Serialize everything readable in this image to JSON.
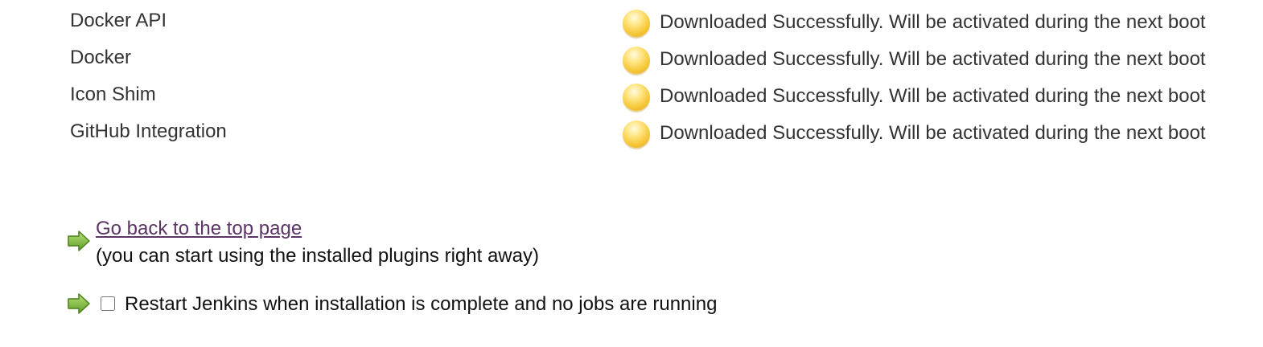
{
  "plugins": [
    {
      "name": "Docker API",
      "status": "Downloaded Successfully. Will be activated during the next boot",
      "status_icon": "yellow-ball-icon"
    },
    {
      "name": "Docker",
      "status": "Downloaded Successfully. Will be activated during the next boot",
      "status_icon": "yellow-ball-icon"
    },
    {
      "name": "Icon Shim",
      "status": "Downloaded Successfully. Will be activated during the next boot",
      "status_icon": "yellow-ball-icon"
    },
    {
      "name": "GitHub Integration",
      "status": "Downloaded Successfully. Will be activated during the next boot",
      "status_icon": "yellow-ball-icon"
    }
  ],
  "actions": {
    "top_link_label": "Go back to the top page",
    "top_link_note": "(you can start using the installed plugins right away)",
    "restart_label": "Restart Jenkins when installation is complete and no jobs are running",
    "restart_checked": false,
    "arrow_icon": "green-arrow-icon"
  },
  "colors": {
    "text": "#333333",
    "link_visited": "#5c3566",
    "status_yellow": "#f7c93a",
    "arrow_green": "#6aa82f"
  }
}
